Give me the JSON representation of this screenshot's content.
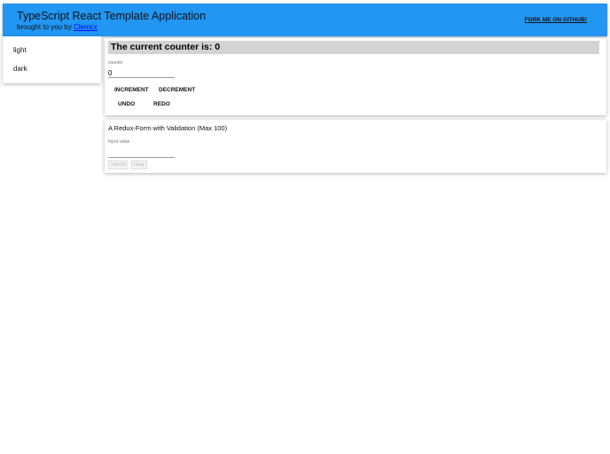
{
  "header": {
    "title": "TypeScript React Template Application",
    "subtitle_prefix": "brought to you by",
    "author_link": "Clemcx",
    "fork_link": "FORK ME ON GITHUB!"
  },
  "sidebar": {
    "items": [
      {
        "label": "light"
      },
      {
        "label": "dark"
      }
    ]
  },
  "counter": {
    "heading": "The current counter is: 0",
    "field_label": "counter",
    "field_value": "0",
    "increment": "INCREMENT",
    "decrement": "DECREMENT",
    "undo": "UNDO",
    "redo": "REDO"
  },
  "form": {
    "title": "A Redux-Form with Validation (Max 100)",
    "input_label": "Input value",
    "input_value": "",
    "submit": "submit",
    "clear": "clear"
  }
}
